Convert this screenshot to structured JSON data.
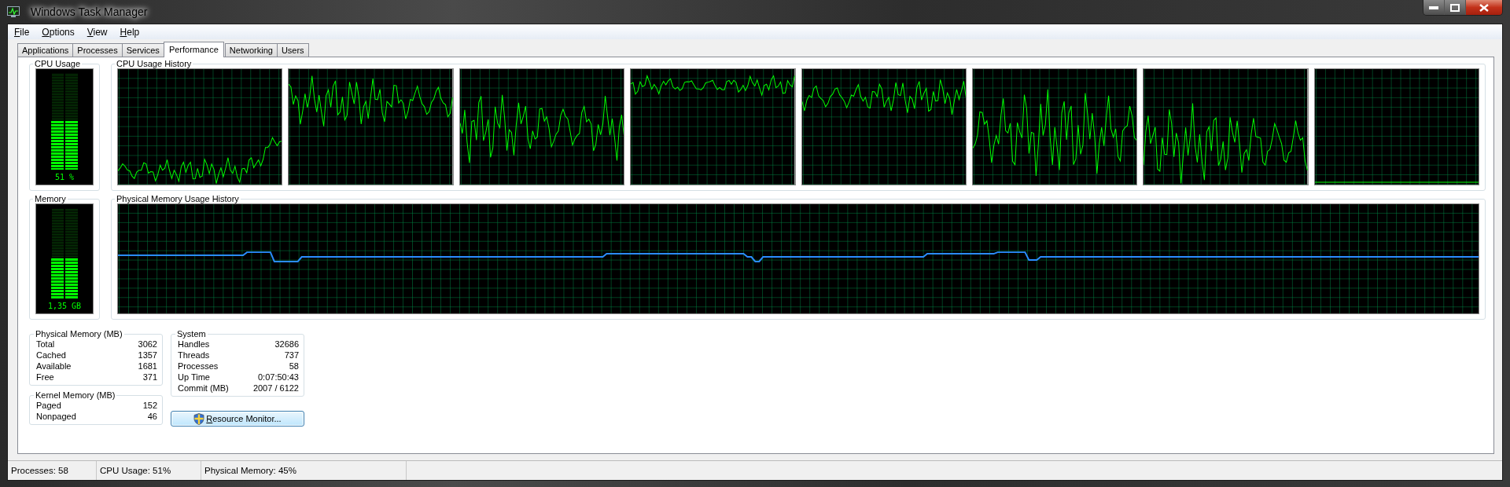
{
  "window": {
    "title": "Windows Task Manager"
  },
  "menu": [
    {
      "mnemonic": "F",
      "rest": "ile"
    },
    {
      "mnemonic": "O",
      "rest": "ptions"
    },
    {
      "mnemonic": "V",
      "rest": "iew"
    },
    {
      "mnemonic": "H",
      "rest": "elp"
    }
  ],
  "tabs": [
    {
      "label": "Applications",
      "selected": false
    },
    {
      "label": "Processes",
      "selected": false
    },
    {
      "label": "Services",
      "selected": false
    },
    {
      "label": "Performance",
      "selected": true
    },
    {
      "label": "Networking",
      "selected": false
    },
    {
      "label": "Users",
      "selected": false
    }
  ],
  "cpu_usage": {
    "title": "CPU Usage",
    "level": 0.51,
    "reading": "51 %"
  },
  "cpu_history": {
    "title": "CPU Usage History"
  },
  "memory": {
    "title": "Memory",
    "level": 0.45,
    "reading": "1,35 GB"
  },
  "memory_history": {
    "title": "Physical Memory Usage History"
  },
  "physical_memory": {
    "title": "Physical Memory (MB)",
    "rows": [
      {
        "label": "Total",
        "value": "3062"
      },
      {
        "label": "Cached",
        "value": "1357"
      },
      {
        "label": "Available",
        "value": "1681"
      },
      {
        "label": "Free",
        "value": "371"
      }
    ]
  },
  "kernel_memory": {
    "title": "Kernel Memory (MB)",
    "rows": [
      {
        "label": "Paged",
        "value": "152"
      },
      {
        "label": "Nonpaged",
        "value": "46"
      }
    ]
  },
  "system": {
    "title": "System",
    "rows": [
      {
        "label": "Handles",
        "value": "32686"
      },
      {
        "label": "Threads",
        "value": "737"
      },
      {
        "label": "Processes",
        "value": "58"
      },
      {
        "label": "Up Time",
        "value": "0:07:50:43"
      },
      {
        "label": "Commit (MB)",
        "value": "2007 / 6122"
      }
    ]
  },
  "resource_monitor_button": {
    "mnemonic": "R",
    "rest": "esource Monitor..."
  },
  "status_bar": [
    "Processes: 58",
    "CPU Usage: 51%",
    "Physical Memory: 45%"
  ]
}
